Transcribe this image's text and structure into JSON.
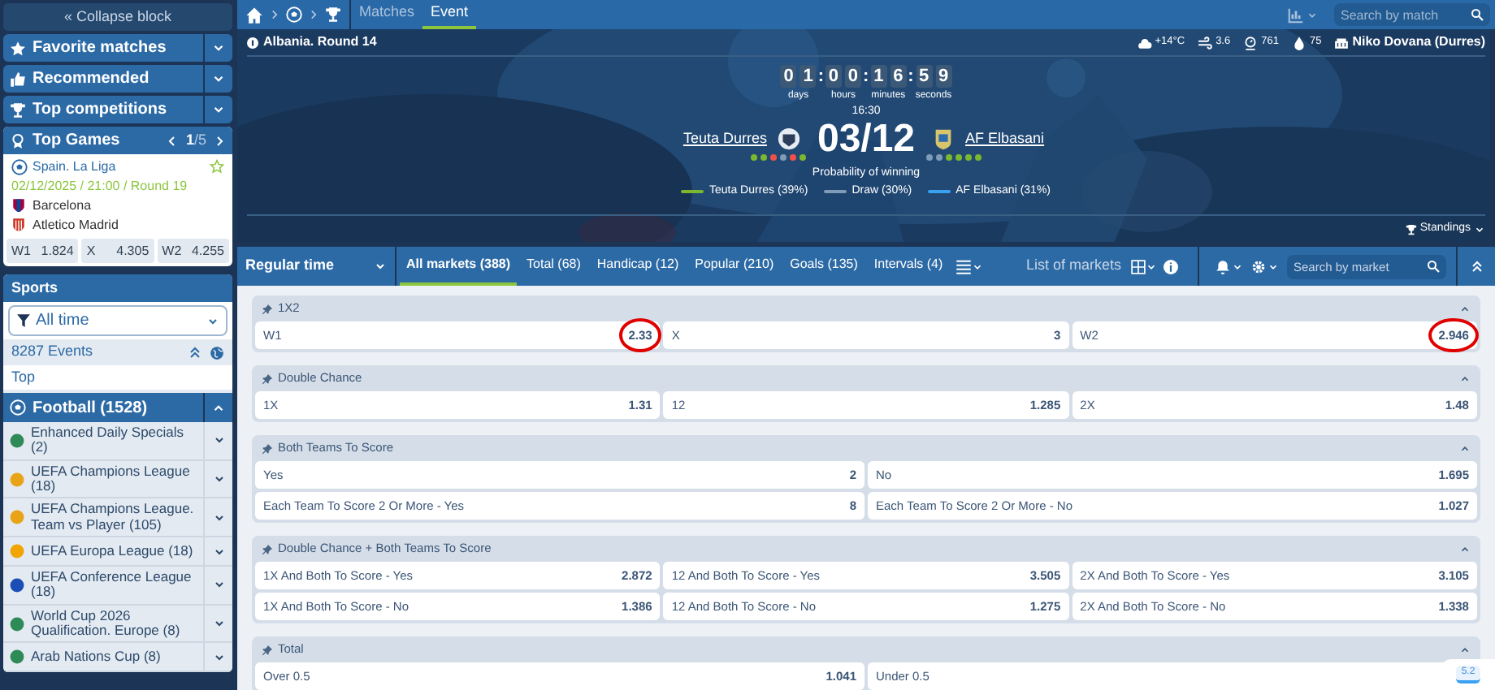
{
  "sidebar": {
    "collapse": "« Collapse block",
    "menus": [
      {
        "label": "Favorite matches"
      },
      {
        "label": "Recommended"
      },
      {
        "label": "Top competitions"
      }
    ],
    "top_games": {
      "title": "Top Games",
      "pager": "1",
      "pager_total": "/5",
      "league": "Spain. La Liga",
      "date": "02/12/2025 / 21:00 / Round 19",
      "teams": [
        "Barcelona",
        "Atletico Madrid"
      ],
      "odds": [
        {
          "label": "W1",
          "value": "1.824"
        },
        {
          "label": "X",
          "value": "4.305"
        },
        {
          "label": "W2",
          "value": "4.255"
        }
      ]
    },
    "sports": {
      "title": "Sports",
      "filter": "All time",
      "events": "8287 Events",
      "top": "Top",
      "sport": "Football (1528)",
      "leagues": [
        {
          "label": "Enhanced Daily Specials (2)",
          "color": "#2e8b57"
        },
        {
          "label": "UEFA Champions League (18)",
          "color": "#e8a316"
        },
        {
          "label": "UEFA Champions League. Team vs Player (105)",
          "color": "#e8a316"
        },
        {
          "label": "UEFA Europa League (18)",
          "color": "#f0a500"
        },
        {
          "label": "UEFA Conference League (18)",
          "color": "#1b4fb5"
        },
        {
          "label": "World Cup 2026 Qualification. Europe (8)",
          "color": "#2e8b57"
        },
        {
          "label": "Arab Nations Cup (8)",
          "color": "#2e8b57"
        }
      ]
    }
  },
  "nav": {
    "tabs": [
      {
        "label": "Matches",
        "selected": false
      },
      {
        "label": "Event",
        "selected": true
      }
    ],
    "search": {
      "placeholder": "Search by match"
    }
  },
  "event": {
    "title": "Albania. Round 14",
    "weather": [
      {
        "kind": "cloud",
        "text": "+14°C"
      },
      {
        "kind": "wind",
        "text": "3.6"
      },
      {
        "kind": "pressure",
        "text": "761"
      },
      {
        "kind": "drop",
        "text": "75"
      },
      {
        "kind": "stadium",
        "text": "Niko Dovana (Durres)"
      }
    ],
    "countdown": [
      {
        "digits": [
          "0",
          "1"
        ],
        "unit": "days"
      },
      {
        "separator": ":",
        "digits": [
          "0",
          "0"
        ],
        "unit": "hours"
      },
      {
        "separator": ":",
        "digits": [
          "1",
          "6"
        ],
        "unit": "minutes"
      },
      {
        "separator": ":",
        "digits": [
          "5",
          "9"
        ],
        "unit": "seconds"
      }
    ],
    "time": "16:30",
    "score": "03/12",
    "team1": {
      "name": "Teuta Durres",
      "form": [
        {
          "color": "#7cb82f"
        },
        {
          "color": "#7cb82f"
        },
        {
          "color": "#f0504a"
        },
        {
          "color": "#7e9bb8"
        },
        {
          "color": "#f0504a"
        },
        {
          "color": "#7cb82f"
        }
      ]
    },
    "team2": {
      "name": "AF Elbasani",
      "form": [
        {
          "color": "#7e9bb8"
        },
        {
          "color": "#7e9bb8"
        },
        {
          "color": "#7cb82f"
        },
        {
          "color": "#7cb82f"
        },
        {
          "color": "#7cb82f"
        },
        {
          "color": "#7cb82f"
        }
      ]
    },
    "probability_title": "Probability of winning",
    "probability": [
      {
        "label": "Teuta Durres (39%)",
        "color": "#7cb82f"
      },
      {
        "label": "Draw (30%)",
        "color": "#7e9bb8"
      },
      {
        "label": "AF Elbasani (31%)",
        "color": "#3aa0f0"
      }
    ],
    "standings": "Standings"
  },
  "markets_bar": {
    "period": "Regular time",
    "tabs": [
      {
        "label": "All markets (388)",
        "selected": true
      },
      {
        "label": "Total (68)",
        "selected": false
      },
      {
        "label": "Handicap (12)",
        "selected": false
      },
      {
        "label": "Popular (210)",
        "selected": false
      },
      {
        "label": "Goals (135)",
        "selected": false
      },
      {
        "label": "Intervals (4)",
        "selected": false
      }
    ],
    "list_label": "List of markets",
    "search": {
      "placeholder": "Search by market"
    }
  },
  "markets": [
    {
      "title": "1X2",
      "rows": [
        [
          {
            "label": "W1",
            "odd": "2.33",
            "circled": true
          },
          {
            "label": "X",
            "odd": "3",
            "circled": false
          },
          {
            "label": "W2",
            "odd": "2.946",
            "circled": true
          }
        ]
      ]
    },
    {
      "title": "Double Chance",
      "rows": [
        [
          {
            "label": "1X",
            "odd": "1.31",
            "circled": false
          },
          {
            "label": "12",
            "odd": "1.285",
            "circled": false
          },
          {
            "label": "2X",
            "odd": "1.48",
            "circled": false
          }
        ]
      ]
    },
    {
      "title": "Both Teams To Score",
      "rows": [
        [
          {
            "label": "Yes",
            "odd": "2",
            "circled": false
          },
          {
            "label": "No",
            "odd": "1.695",
            "circled": false
          }
        ],
        [
          {
            "label": "Each Team To Score 2 Or More - Yes",
            "odd": "8",
            "circled": false
          },
          {
            "label": "Each Team To Score 2 Or More - No",
            "odd": "1.027",
            "circled": false
          }
        ]
      ]
    },
    {
      "title": "Double Chance + Both Teams To Score",
      "rows": [
        [
          {
            "label": "1X And Both To Score - Yes",
            "odd": "2.872",
            "circled": false
          },
          {
            "label": "12 And Both To Score - Yes",
            "odd": "3.505",
            "circled": false
          },
          {
            "label": "2X And Both To Score - Yes",
            "odd": "3.105",
            "circled": false
          }
        ],
        [
          {
            "label": "1X And Both To Score - No",
            "odd": "1.386",
            "circled": false
          },
          {
            "label": "12 And Both To Score - No",
            "odd": "1.275",
            "circled": false
          },
          {
            "label": "2X And Both To Score - No",
            "odd": "1.338",
            "circled": false
          }
        ]
      ]
    },
    {
      "title": "Total",
      "rows": [
        [
          {
            "label": "Over 0.5",
            "odd": "1.041",
            "circled": false
          },
          {
            "label": "Under 0.5",
            "circled": false
          }
        ]
      ]
    }
  ],
  "bet_widget": {
    "text": "5.2"
  }
}
